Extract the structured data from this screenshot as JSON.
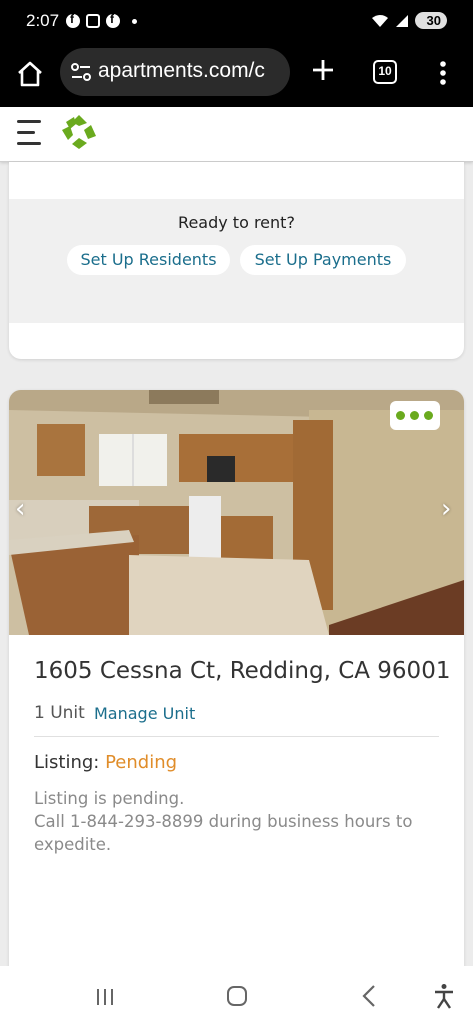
{
  "status_bar": {
    "time": "2:07",
    "battery": "30",
    "icons": [
      "facebook-icon",
      "screenshot-icon",
      "facebook-icon",
      "notification-dot-icon",
      "wifi-icon",
      "signal-icon",
      "battery-icon"
    ]
  },
  "browser": {
    "url": "apartments.com/c",
    "tab_count": "10"
  },
  "card_setup": {
    "prompt": "Ready to rent?",
    "residents_button": "Set Up Residents",
    "payments_button": "Set Up Payments"
  },
  "property": {
    "address": "1605 Cessna Ct, Redding, CA 96001",
    "units": "1 Unit",
    "manage_link": "Manage Unit",
    "listing_label": "Listing: ",
    "listing_status": "Pending",
    "pending_line1": "Listing is pending.",
    "pending_line2": "Call 1-844-293-8899 during business hours to expedite."
  },
  "colors": {
    "brand_green": "#6aaa1e",
    "link_blue": "#1b6e8c",
    "pending_orange": "#e08d2a"
  }
}
